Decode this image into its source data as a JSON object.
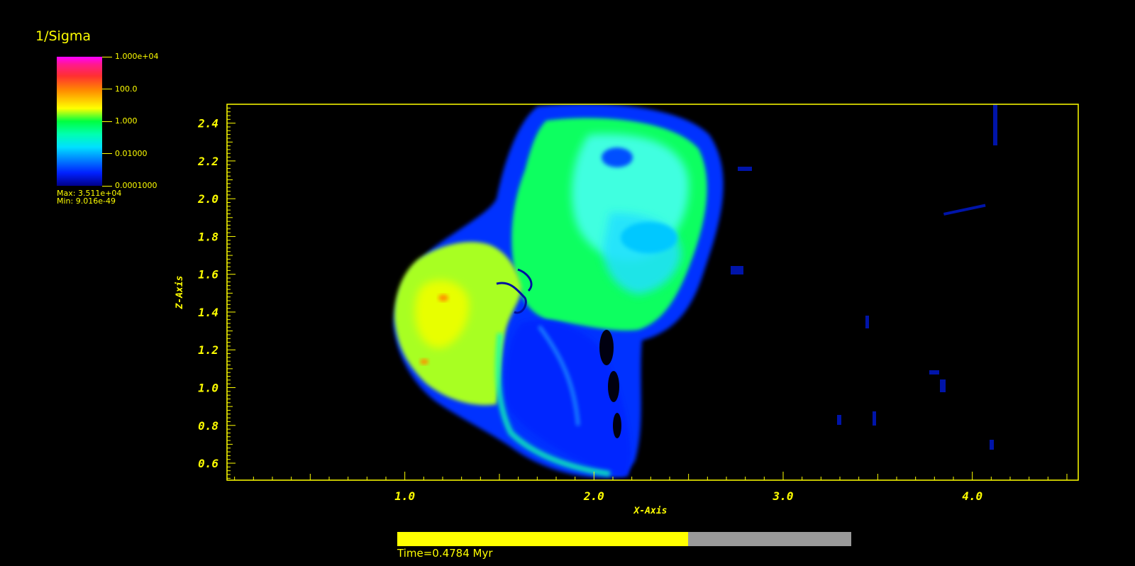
{
  "legend": {
    "title": "1/Sigma",
    "ticks": [
      "1.000e+04",
      "100.0",
      "1.000",
      "0.01000",
      "0.0001000"
    ],
    "max_label": "Max: 3.511e+04",
    "min_label": "Min: 9.016e-49"
  },
  "time": {
    "label": "Time=0.4784 Myr",
    "progress": 0.64
  },
  "colors": {
    "foreground": "#ffff00",
    "background": "#000000",
    "progress_track": "#9a9a9a"
  },
  "chart_data": {
    "type": "heatmap",
    "xlabel": "X-Axis",
    "ylabel": "Z-Axis",
    "xlim": [
      0.06,
      4.56
    ],
    "ylim": [
      0.51,
      2.5
    ],
    "xticks": [
      1.0,
      2.0,
      3.0,
      4.0
    ],
    "xtick_labels": [
      "1.0",
      "2.0",
      "3.0",
      "4.0"
    ],
    "yticks": [
      0.6,
      0.8,
      1.0,
      1.2,
      1.4,
      1.6,
      1.8,
      2.0,
      2.2,
      2.4
    ],
    "ytick_labels": [
      "0.6",
      "0.8",
      "1.0",
      "1.2",
      "1.4",
      "1.6",
      "1.8",
      "2.0",
      "2.2",
      "2.4"
    ],
    "colorbar_range": [
      0.0001,
      10000
    ],
    "colorbar_scale": "log",
    "colormap": "rainbow (dark blue to magenta)",
    "grid": false
  }
}
